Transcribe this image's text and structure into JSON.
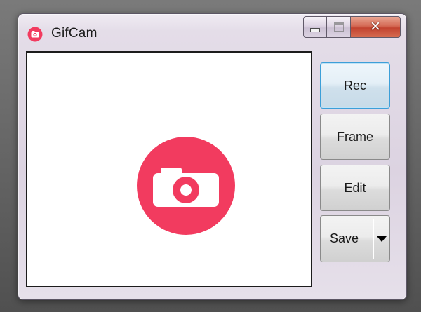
{
  "window": {
    "title": "GifCam",
    "app_icon": "gifcam-logo-icon",
    "caption_buttons": {
      "minimize_icon": "minimize-icon",
      "maximize_icon": "maximize-icon",
      "close_icon": "close-icon",
      "close_glyph": "✕"
    }
  },
  "capture_area": {
    "center_icon": "camera-icon"
  },
  "buttons": {
    "rec_label": "Rec",
    "frame_label": "Frame",
    "edit_label": "Edit",
    "save_label": "Save",
    "save_dropdown_icon": "dropdown-arrow-icon"
  },
  "colors": {
    "brand": "#f23b5f",
    "focus_border": "#3c9fd8",
    "close_button": "#c94a35"
  }
}
